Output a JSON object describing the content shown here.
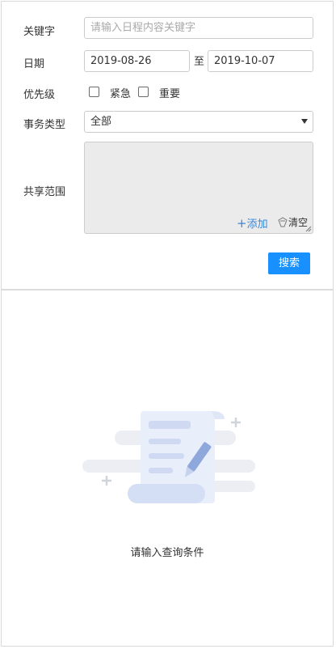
{
  "form": {
    "keyword": {
      "label": "关键字",
      "placeholder": "请输入日程内容关键字"
    },
    "date": {
      "label": "日期",
      "start": "2019-08-26",
      "separator": "至",
      "end": "2019-10-07"
    },
    "priority": {
      "label": "优先级",
      "options": [
        "紧急",
        "重要"
      ]
    },
    "event_type": {
      "label": "事务类型",
      "selected": "全部"
    },
    "share_scope": {
      "label": "共享范围",
      "add_label": "添加",
      "clear_label": "清空"
    },
    "search_label": "搜索"
  },
  "empty_state": {
    "message": "请输入查询条件"
  },
  "colors": {
    "primary": "#1890ff",
    "link": "#3b86d8",
    "border": "#cccccc"
  }
}
